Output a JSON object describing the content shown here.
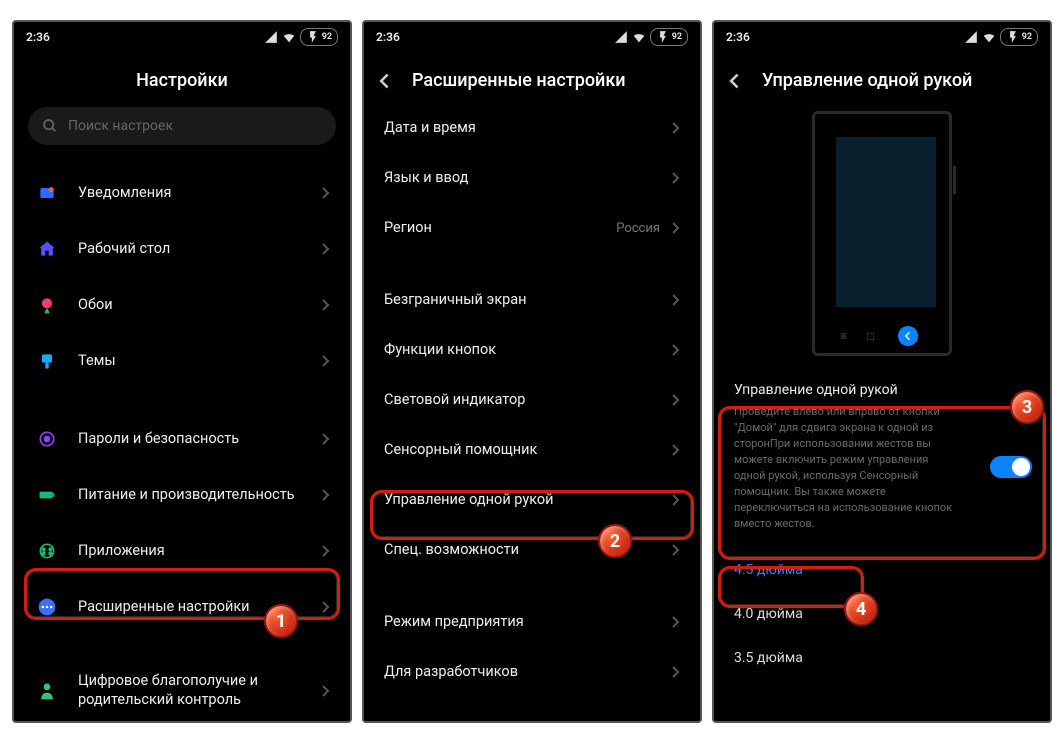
{
  "status": {
    "time": "2:36",
    "battery": "92"
  },
  "screen1": {
    "title": "Настройки",
    "search_placeholder": "Поиск настроек",
    "items": [
      {
        "label": "Уведомления"
      },
      {
        "label": "Рабочий стол"
      },
      {
        "label": "Обои"
      },
      {
        "label": "Темы"
      }
    ],
    "items2": [
      {
        "label": "Пароли и безопасность"
      },
      {
        "label": "Питание и производительность"
      },
      {
        "label": "Приложения"
      },
      {
        "label": "Расширенные настройки"
      }
    ],
    "items3": [
      {
        "label": "Цифровое благополучие и родительский контроль"
      }
    ]
  },
  "screen2": {
    "title": "Расширенные настройки",
    "items": [
      {
        "label": "Дата и время"
      },
      {
        "label": "Язык и ввод"
      },
      {
        "label": "Регион",
        "value": "Россия"
      }
    ],
    "items2": [
      {
        "label": "Безграничный экран"
      },
      {
        "label": "Функции кнопок"
      },
      {
        "label": "Световой индикатор"
      },
      {
        "label": "Сенсорный помощник"
      },
      {
        "label": "Управление одной рукой"
      },
      {
        "label": "Спец. возможности"
      }
    ],
    "items3": [
      {
        "label": "Режим предприятия"
      },
      {
        "label": "Для разработчиков"
      }
    ]
  },
  "screen3": {
    "title": "Управление одной рукой",
    "setting_title": "Управление одной рукой",
    "setting_desc": "Проведите влево или вправо от кнопки \"Домой\" для сдвига экрана к одной из сторонПри использовании жестов вы можете включить режим управления одной рукой, используя Сенсорный помощник. Вы также можете переключиться на использование кнопок вместо жестов.",
    "options": [
      {
        "label": "4.5 дюйма",
        "active": true
      },
      {
        "label": "4.0 дюйма",
        "active": false
      },
      {
        "label": "3.5 дюйма",
        "active": false
      }
    ]
  },
  "badges": {
    "b1": "1",
    "b2": "2",
    "b3": "3",
    "b4": "4"
  }
}
